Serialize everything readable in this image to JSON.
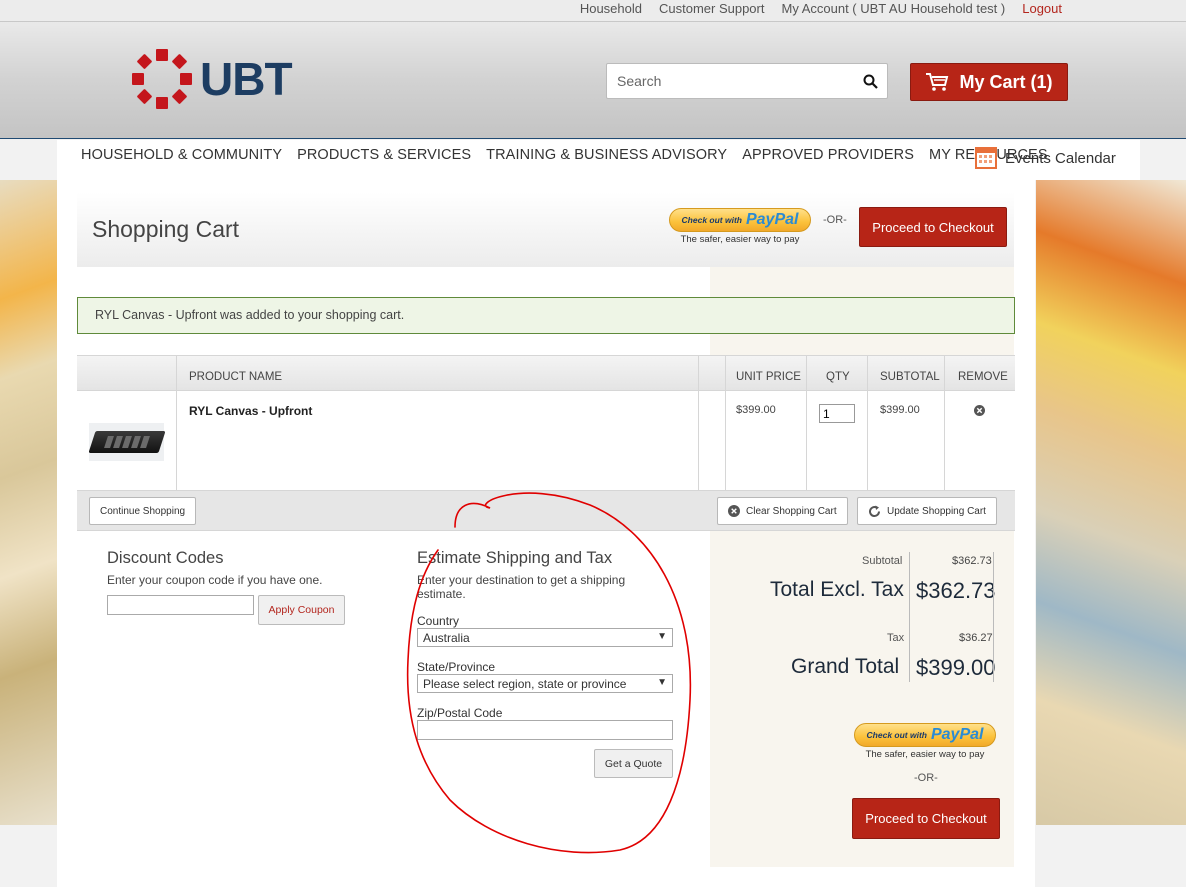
{
  "topbar": {
    "links": [
      "Household",
      "Customer Support",
      "My Account ( UBT AU Household test )"
    ],
    "logout": "Logout"
  },
  "header": {
    "logo_text": "UBT",
    "search_placeholder": "Search",
    "cart_label": "My Cart (1)"
  },
  "nav": {
    "items": [
      "HOUSEHOLD & COMMUNITY",
      "PRODUCTS & SERVICES",
      "TRAINING & BUSINESS ADVISORY",
      "APPROVED PROVIDERS",
      "MY RESOURCES"
    ],
    "events_label": "Events Calendar"
  },
  "cart": {
    "title": "Shopping Cart",
    "paypal_checkout": "Check out with",
    "paypal_brand": "PayPal",
    "paypal_tagline": "The safer, easier way to pay",
    "or_label": "-OR-",
    "proceed_label": "Proceed to Checkout",
    "notice": "RYL Canvas - Upfront was added to your shopping cart."
  },
  "table": {
    "headers": {
      "product_name": "PRODUCT NAME",
      "unit_price": "UNIT PRICE",
      "qty": "QTY",
      "subtotal": "SUBTOTAL",
      "remove": "REMOVE"
    },
    "rows": [
      {
        "name": "RYL Canvas - Upfront",
        "unit_price": "$399.00",
        "qty": "1",
        "subtotal": "$399.00"
      }
    ]
  },
  "actions": {
    "continue": "Continue Shopping",
    "clear": "Clear Shopping Cart",
    "update": "Update Shopping Cart"
  },
  "discount": {
    "title": "Discount Codes",
    "hint": "Enter your coupon code if you have one.",
    "coupon_value": "",
    "apply_label": "Apply Coupon"
  },
  "shipping": {
    "title": "Estimate Shipping and Tax",
    "hint": "Enter your destination to get a shipping estimate.",
    "country_label": "Country",
    "country_value": "Australia",
    "state_label": "State/Province",
    "state_value": "Please select region, state or province",
    "zip_label": "Zip/Postal Code",
    "zip_value": "",
    "quote_label": "Get a Quote"
  },
  "totals": {
    "subtotal_label": "Subtotal",
    "subtotal_value": "$362.73",
    "excl_label": "Total Excl. Tax",
    "excl_value": "$362.73",
    "tax_label": "Tax",
    "tax_value": "$36.27",
    "grand_label": "Grand Total",
    "grand_value": "$399.00"
  },
  "colors": {
    "brand_red": "#b72517",
    "brand_navy": "#1d3d62",
    "annotation_red": "#e00000"
  }
}
